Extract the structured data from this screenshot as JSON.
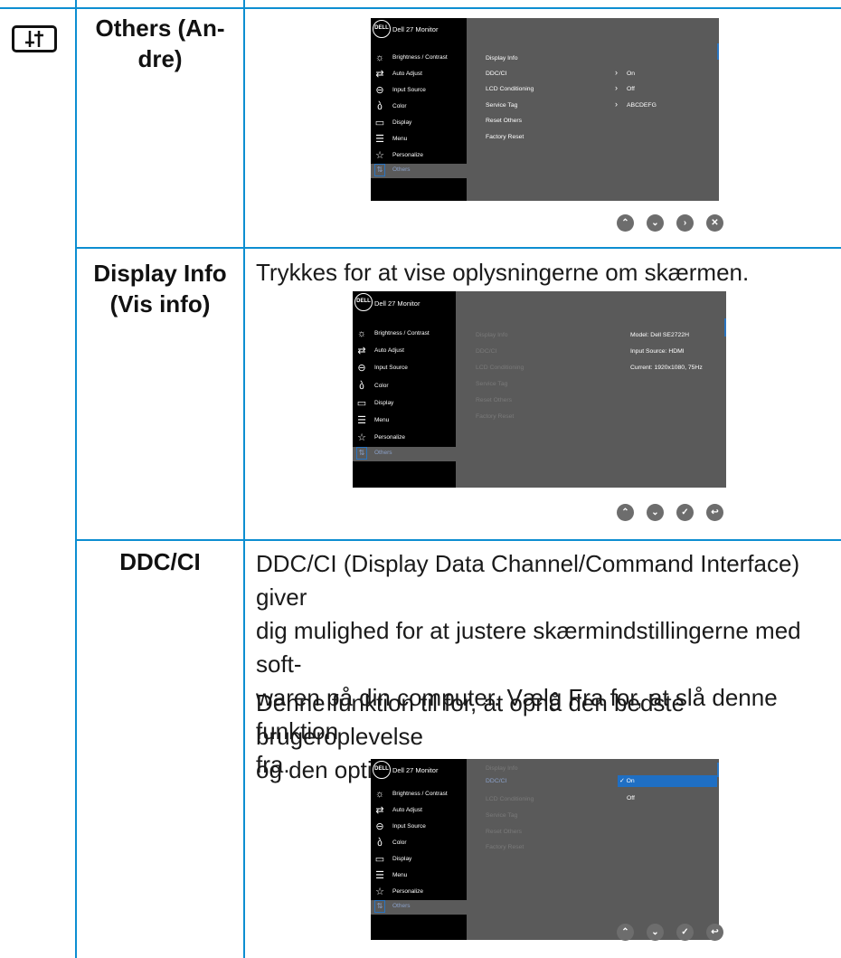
{
  "sidebar_icon": "adjustment-sliders-icon",
  "rows": [
    {
      "label_lines": [
        "Others (An-",
        "dre)"
      ]
    },
    {
      "label_lines": [
        "Display Info",
        "(Vis info)"
      ],
      "text": "Trykkes for at vise oplysningerne om skærmen."
    },
    {
      "label_lines": [
        "DDC/CI"
      ],
      "paragraphs": [
        [
          "DDC/CI (Display Data Channel/Command Interface) giver",
          "dig mulighed for at justere skærmindstillingerne med soft-",
          "waren på din computer. Vælg Fra for, at slå denne funktion",
          "fra."
        ],
        [
          "Denne funktion til for, at opnå den bedste brugeroplevelse",
          "og den optimale ydeevne."
        ]
      ]
    }
  ],
  "osd": {
    "logo": "DELL",
    "title": "Dell 27 Monitor",
    "menu": [
      {
        "icon": "brightness-icon",
        "glyph": "☼",
        "label": "Brightness / Contrast"
      },
      {
        "icon": "auto-adjust-icon",
        "glyph": "⇄",
        "label": "Auto Adjust"
      },
      {
        "icon": "input-source-icon",
        "glyph": "⊖",
        "label": "Input Source"
      },
      {
        "icon": "color-icon",
        "glyph": "ბ",
        "label": "Color"
      },
      {
        "icon": "display-icon",
        "glyph": "▭",
        "label": "Display"
      },
      {
        "icon": "menu-icon",
        "glyph": "☰",
        "label": "Menu"
      },
      {
        "icon": "personalize-icon",
        "glyph": "☆",
        "label": "Personalize"
      },
      {
        "icon": "others-icon",
        "glyph": "⇅",
        "label": "Others"
      }
    ],
    "submenu": [
      "Display Info",
      "DDC/CI",
      "LCD Conditioning",
      "Service Tag",
      "Reset Others",
      "Factory Reset"
    ],
    "screen1_values": [
      "On",
      "Off",
      "ABCDEFG"
    ],
    "screen2_info": [
      "Model: Dell SE2722H",
      "Input Source: HDMI",
      "Current: 1920x1080, 75Hz"
    ],
    "screen3_options": [
      "✓ On",
      "Off"
    ]
  },
  "buttons": {
    "set1": [
      {
        "icon": "up-icon",
        "glyph": "⌃"
      },
      {
        "icon": "down-icon",
        "glyph": "⌄"
      },
      {
        "icon": "right-icon",
        "glyph": "›"
      },
      {
        "icon": "exit-icon",
        "glyph": "✕"
      }
    ],
    "set2": [
      {
        "icon": "up-icon",
        "glyph": "⌃"
      },
      {
        "icon": "down-icon",
        "glyph": "⌄"
      },
      {
        "icon": "check-icon",
        "glyph": "✓"
      },
      {
        "icon": "back-icon",
        "glyph": "↩"
      }
    ]
  },
  "colors": {
    "rule": "#0d8ed1",
    "osd_bg": "#000000",
    "osd_panel": "#5a5a5a",
    "highlight": "#1f6fc4"
  }
}
